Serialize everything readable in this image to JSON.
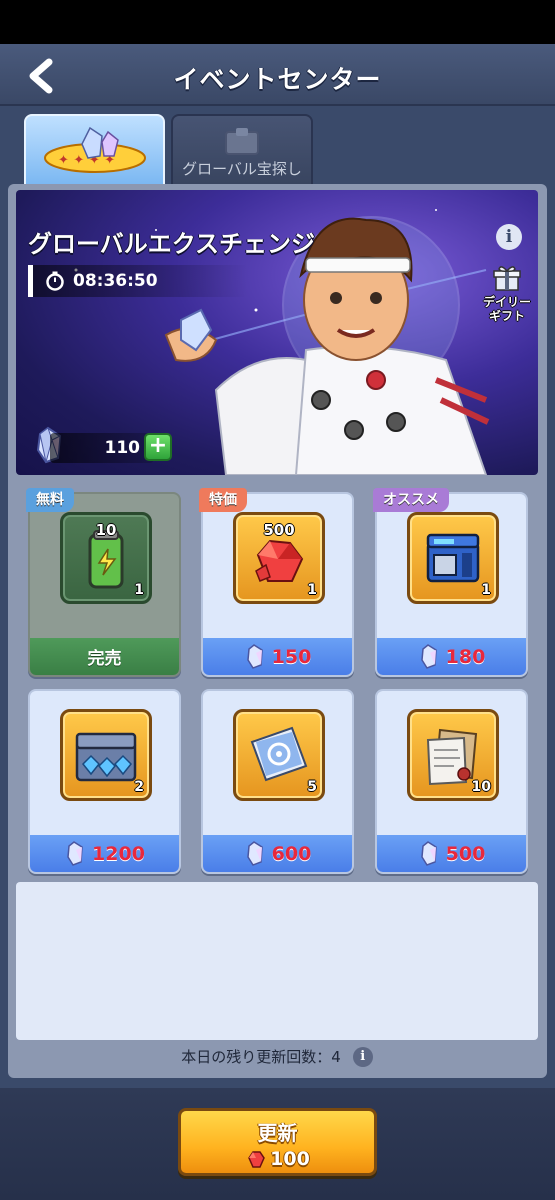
{
  "header": {
    "title": "イベントセンター"
  },
  "tabs": [
    {
      "label": ""
    },
    {
      "label": "グローバル宝探し"
    }
  ],
  "banner": {
    "title": "グローバルエクスチェンジ",
    "timer": "08:36:50",
    "daily_gift_line1": "デイリー",
    "daily_gift_line2": "ギフト",
    "currency_amount": "110",
    "plus_label": "+",
    "info_label": "i"
  },
  "shop": {
    "items": [
      {
        "tag": "無料",
        "amount": "10",
        "count": "1",
        "price": "",
        "status": "完売",
        "icon": "green-battery-icon"
      },
      {
        "tag": "特価",
        "amount": "500",
        "count": "1",
        "price": "150",
        "status": "",
        "icon": "red-gem-icon"
      },
      {
        "tag": "オススメ",
        "amount": "",
        "count": "1",
        "price": "180",
        "status": "",
        "icon": "blue-machine-icon"
      },
      {
        "tag": "",
        "amount": "",
        "count": "2",
        "price": "1200",
        "status": "",
        "icon": "crystal-chest-icon"
      },
      {
        "tag": "",
        "amount": "",
        "count": "5",
        "price": "600",
        "status": "",
        "icon": "blueprint-icon"
      },
      {
        "tag": "",
        "amount": "",
        "count": "10",
        "price": "500",
        "status": "",
        "icon": "documents-icon"
      }
    ]
  },
  "footer": {
    "refresh_info": "本日の残り更新回数：4",
    "refresh_button_label": "更新",
    "refresh_cost": "100"
  },
  "colors": {
    "price_red": "#e8283c",
    "price_bar_blue": "#4a7ee8",
    "sold_green": "#3a7f45",
    "button_gold": "#ffb21f"
  }
}
